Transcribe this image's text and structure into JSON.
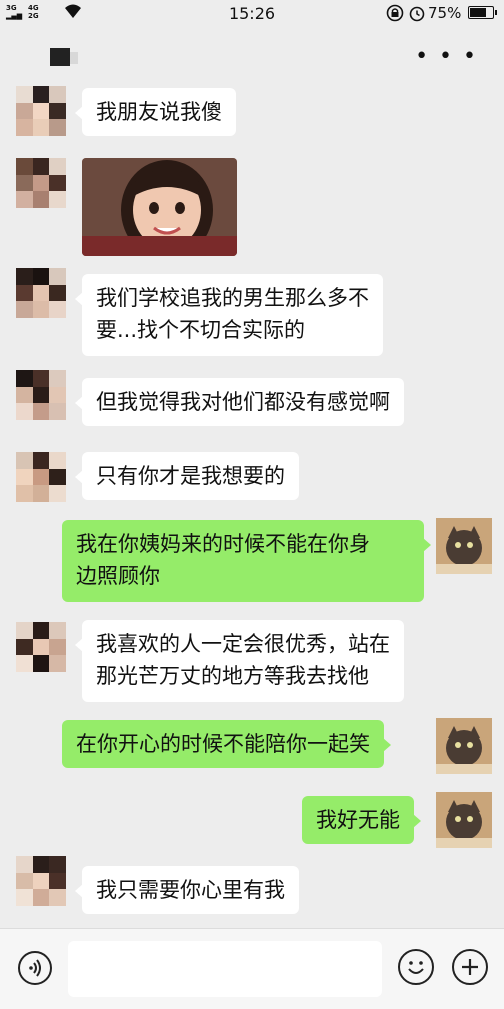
{
  "status_bar": {
    "network_top": "3G",
    "network_bottom": "",
    "network2_top": "4G",
    "network2_bottom": "2G",
    "time": "15:26",
    "battery": "75%",
    "battery_level": 0.75,
    "icons": [
      "signal-icon",
      "wifi-icon",
      "lock-icon",
      "alarm-icon",
      "battery-icon"
    ]
  },
  "header": {
    "more_label": "• • •"
  },
  "messages": [
    {
      "side": "left",
      "text": "我朋友说我傻"
    },
    {
      "side": "left",
      "type": "image",
      "image": "girl-photo"
    },
    {
      "side": "left",
      "line1": "我们学校追我的男生那么多不",
      "line2": "要...找个不切合实际的"
    },
    {
      "side": "left",
      "text": "但我觉得我对他们都没有感觉啊"
    },
    {
      "side": "left",
      "text": "只有你才是我想要的"
    },
    {
      "side": "right",
      "line1": "我在你姨妈来的时候不能在你身",
      "line2": "边照顾你"
    },
    {
      "side": "left",
      "line1": "我喜欢的人一定会很优秀，站在",
      "line2": "那光芒万丈的地方等我去找他"
    },
    {
      "side": "right",
      "text": "在你开心的时候不能陪你一起笑"
    },
    {
      "side": "right",
      "text": "我好无能"
    },
    {
      "side": "left",
      "text": "我只需要你心里有我"
    }
  ],
  "input_bar": {
    "voice_icon": "voice-icon",
    "emoji_icon": "emoji-icon",
    "plus_icon": "plus-icon"
  },
  "colors": {
    "chat_background": "#ededed",
    "incoming_bubble": "#ffffff",
    "outgoing_bubble": "#95ec69"
  }
}
